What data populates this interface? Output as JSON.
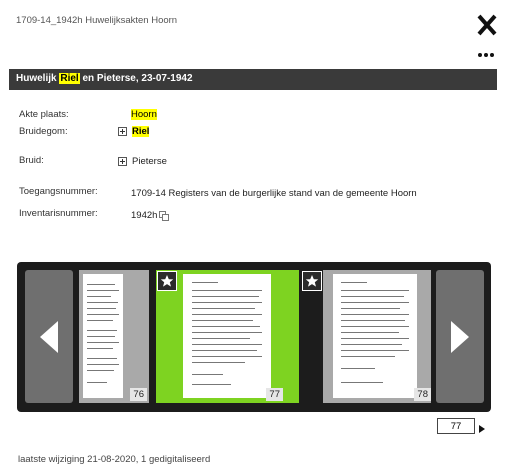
{
  "dialog": {
    "doc_title": "1709-14_1942h Huwelijksakten Hoorn",
    "close_icon": "close-icon",
    "more_icon": "more-options-icon"
  },
  "header": {
    "prefix": "Huwelijk ",
    "highlight": "Riel",
    "suffix": " en Pieterse, 23-07-1942"
  },
  "details": {
    "place_label": "Akte plaats:",
    "place_value": "Hoorn",
    "groom_label": "Bruidegom:",
    "groom_value": "Riel",
    "bride_label": "Bruid:",
    "bride_value": "Pieterse",
    "access_label": "Toegangsnummer:",
    "access_value": "1709-14 Registers van de burgerlijke stand van de gemeente Hoorn",
    "inventory_label": "Inventarisnummer:",
    "inventory_value": "1942h"
  },
  "viewer": {
    "thumbs": [
      {
        "number": "76",
        "state": "normal",
        "starred": false
      },
      {
        "number": "77",
        "state": "selected",
        "starred": true
      },
      {
        "number": "78",
        "state": "normal",
        "starred": true
      }
    ],
    "current_page": "77"
  },
  "footer": {
    "text": "laatste wijziging 21-08-2020,  1 gedigitaliseerd"
  },
  "colors": {
    "header_bg": "#3a3a3a",
    "highlight": "#ffff00",
    "selected_thumb": "#7ed321",
    "viewer_bg": "#1c1c1c"
  }
}
